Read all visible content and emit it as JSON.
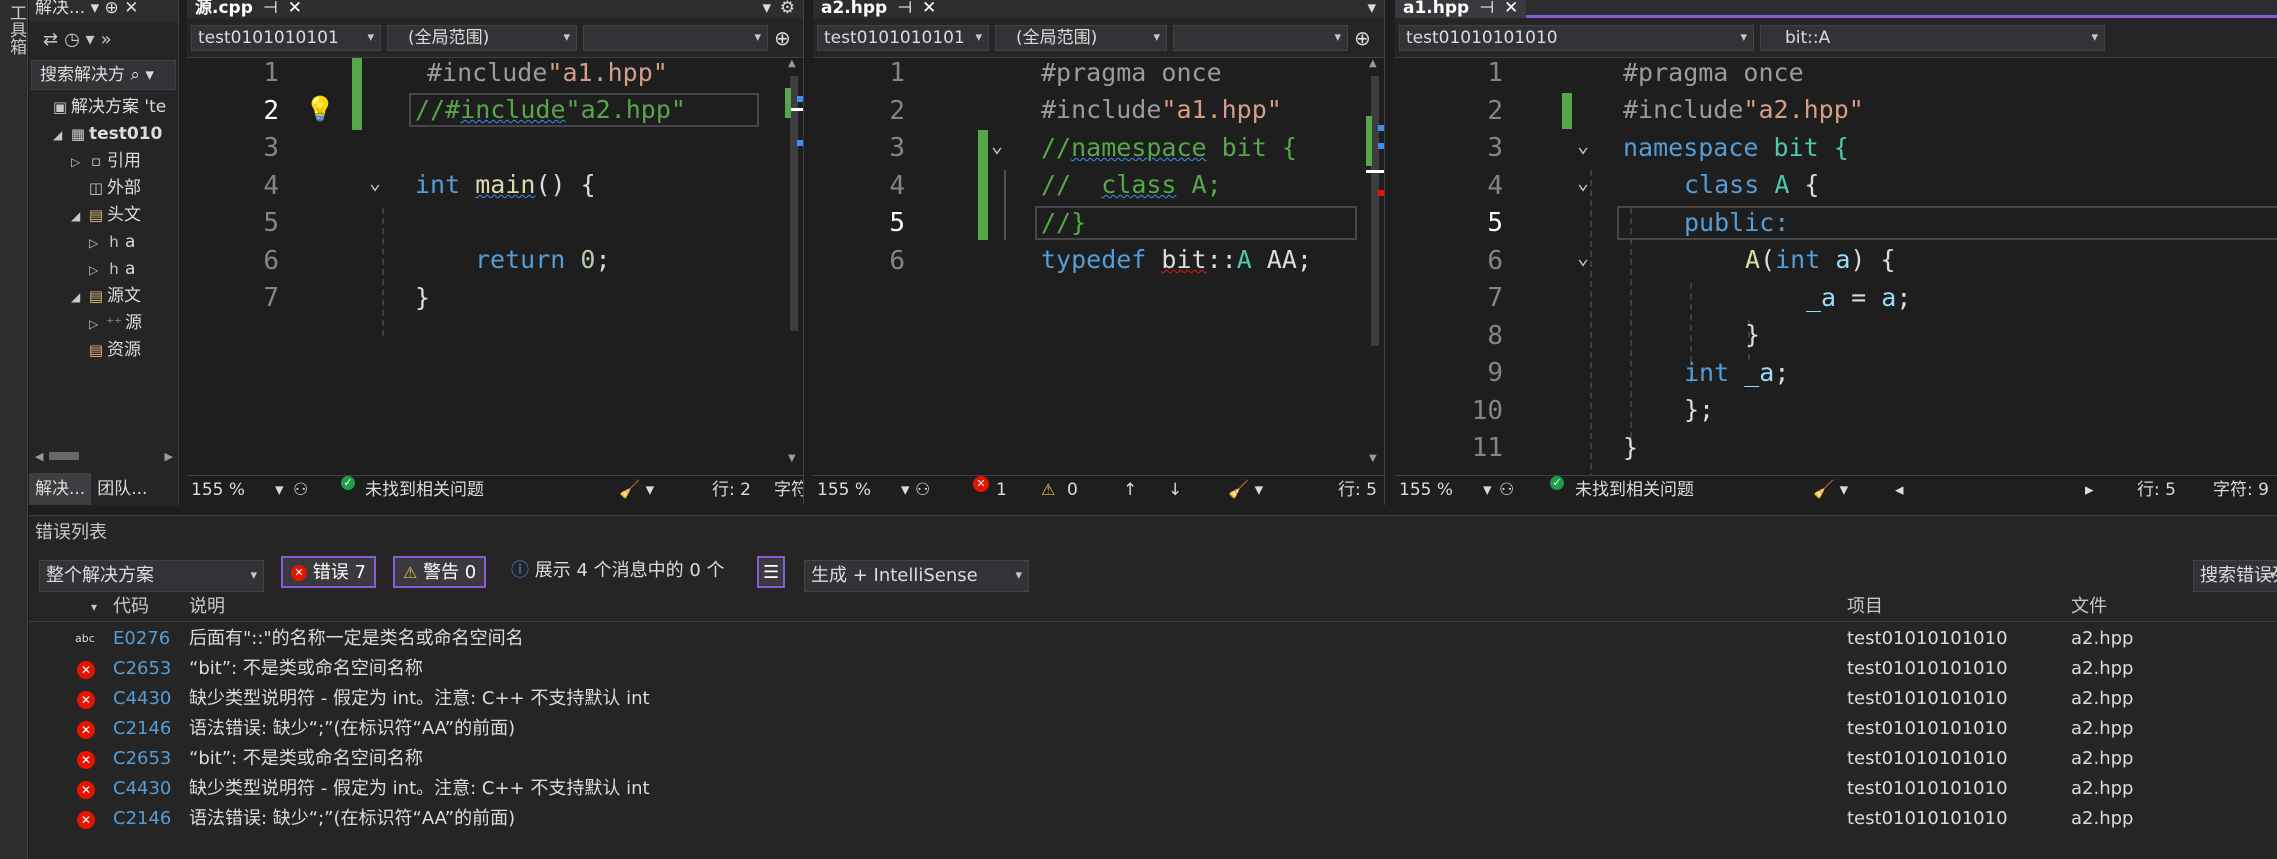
{
  "left_strip": {
    "label": "工具箱"
  },
  "solution_explorer": {
    "title": "解决... ▾ ⊕ ✕",
    "search_placeholder": "搜索解决方 ⌕ ▾",
    "tree": [
      {
        "label": "解决方案 'te",
        "icon": "solution-icon",
        "indent": 0,
        "arrow": ""
      },
      {
        "label": "test010",
        "icon": "project-icon",
        "indent": 1,
        "arrow": "◢"
      },
      {
        "label": "引用",
        "icon": "references-icon",
        "indent": 2,
        "arrow": "▷"
      },
      {
        "label": "外部",
        "icon": "external-deps-icon",
        "indent": 2,
        "arrow": ""
      },
      {
        "label": "头文",
        "icon": "folder-icon",
        "indent": 2,
        "arrow": "◢"
      },
      {
        "label": "a",
        "icon": "header-file-icon",
        "indent": 3,
        "arrow": "▷"
      },
      {
        "label": "a",
        "icon": "header-file-icon",
        "indent": 3,
        "arrow": "▷"
      },
      {
        "label": "源文",
        "icon": "folder-icon",
        "indent": 2,
        "arrow": "◢"
      },
      {
        "label": "源",
        "icon": "cpp-file-icon",
        "indent": 3,
        "arrow": "▷"
      },
      {
        "label": "资源",
        "icon": "folder-icon",
        "indent": 2,
        "arrow": ""
      }
    ],
    "bottom_tabs": [
      "解决...",
      "团队..."
    ]
  },
  "editors": [
    {
      "tab": "源.cpp",
      "project_dd": "test0101010101",
      "scope_dd": "(全局范围)",
      "member_dd": "",
      "zoom": "155 %",
      "issues": "未找到相关问题",
      "line_label": "行: 2",
      "char_label": "字符",
      "lines": [
        "1",
        "2",
        "3",
        "4",
        "5",
        "6",
        "7"
      ]
    },
    {
      "tab": "a2.hpp",
      "project_dd": "test0101010101",
      "scope_dd": "(全局范围)",
      "member_dd": "",
      "zoom": "155 %",
      "errors": "1",
      "warnings": "0",
      "line_label": "行: 5",
      "lines": [
        "1",
        "2",
        "3",
        "4",
        "5",
        "6"
      ]
    },
    {
      "tab": "a1.hpp",
      "project_dd": "test01010101010",
      "scope_dd": "bit::A",
      "zoom": "155 %",
      "issues": "未找到相关问题",
      "line_label": "行: 5",
      "char_label": "字符: 9",
      "lines": [
        "1",
        "2",
        "3",
        "4",
        "5",
        "6",
        "7",
        "8",
        "9",
        "10",
        "11"
      ]
    }
  ],
  "code1": {
    "l1a": "#include",
    "l1b": "\"a1.hpp\"",
    "l2a": "//#",
    "l2b": "include",
    "l2c": "\"a2.hpp\"",
    "l4a": "int",
    "l4b": "main",
    "l4c": "() {",
    "l6a": "return",
    "l6b": "0",
    "l6c": ";",
    "l7": "}"
  },
  "code2": {
    "l1": "#pragma once",
    "l2a": "#include",
    "l2b": "\"a1.hpp\"",
    "l3a": "//",
    "l3b": "namespace",
    "l3c": " bit {",
    "l4a": "//  ",
    "l4b": "class",
    "l4c": " A;",
    "l5": "//}",
    "l6a": "typedef",
    "l6b": "bit",
    "l6c": "::",
    "l6d": "A",
    "l6e": " AA;"
  },
  "code3": {
    "l1": "#pragma once",
    "l2a": "#include",
    "l2b": "\"a2.hpp\"",
    "l3a": "namespace",
    "l3b": " bit {",
    "l4a": "class",
    "l4b": " A",
    "l4c": " {",
    "l5": "public:",
    "l6a": "A",
    "l6b": "(",
    "l6c": "int",
    "l6d": " a",
    "l6e": ") {",
    "l7a": "_a",
    "l7b": " = ",
    "l7c": "a",
    "l7d": ";",
    "l8": "}",
    "l9a": "int",
    "l9b": " _a",
    "l9c": ";",
    "l10": "};",
    "l11": "}"
  },
  "error_list": {
    "title": "错误列表",
    "scope": "整个解决方案",
    "errors_btn": "错误 7",
    "warnings_btn": "警告 0",
    "messages": "展示 4 个消息中的 0 个",
    "build_dd": "生成 + IntelliSense",
    "search": "搜索错误列",
    "columns": {
      "code": "代码",
      "desc": "说明",
      "project": "项目",
      "file": "文件"
    },
    "rows": [
      {
        "code": "E0276",
        "desc": "后面有\"::\"的名称一定是类名或命名空间名",
        "project": "test01010101010",
        "file": "a2.hpp",
        "kind": "intellisense"
      },
      {
        "code": "C2653",
        "desc": "“bit”: 不是类或命名空间名称",
        "project": "test01010101010",
        "file": "a2.hpp",
        "kind": "error"
      },
      {
        "code": "C4430",
        "desc": "缺少类型说明符 - 假定为 int。注意: C++ 不支持默认 int",
        "project": "test01010101010",
        "file": "a2.hpp",
        "kind": "error"
      },
      {
        "code": "C2146",
        "desc": "语法错误: 缺少“;”(在标识符“AA”的前面)",
        "project": "test01010101010",
        "file": "a2.hpp",
        "kind": "error"
      },
      {
        "code": "C2653",
        "desc": "“bit”: 不是类或命名空间名称",
        "project": "test01010101010",
        "file": "a2.hpp",
        "kind": "error"
      },
      {
        "code": "C4430",
        "desc": "缺少类型说明符 - 假定为 int。注意: C++ 不支持默认 int",
        "project": "test01010101010",
        "file": "a2.hpp",
        "kind": "error"
      },
      {
        "code": "C2146",
        "desc": "语法错误: 缺少“;”(在标识符“AA”的前面)",
        "project": "test01010101010",
        "file": "a2.hpp",
        "kind": "error"
      }
    ]
  },
  "colors": {
    "accent": "#8a5bd6",
    "error": "#e51400",
    "ok": "#1c9e4b",
    "added_line": "#57a64a"
  }
}
